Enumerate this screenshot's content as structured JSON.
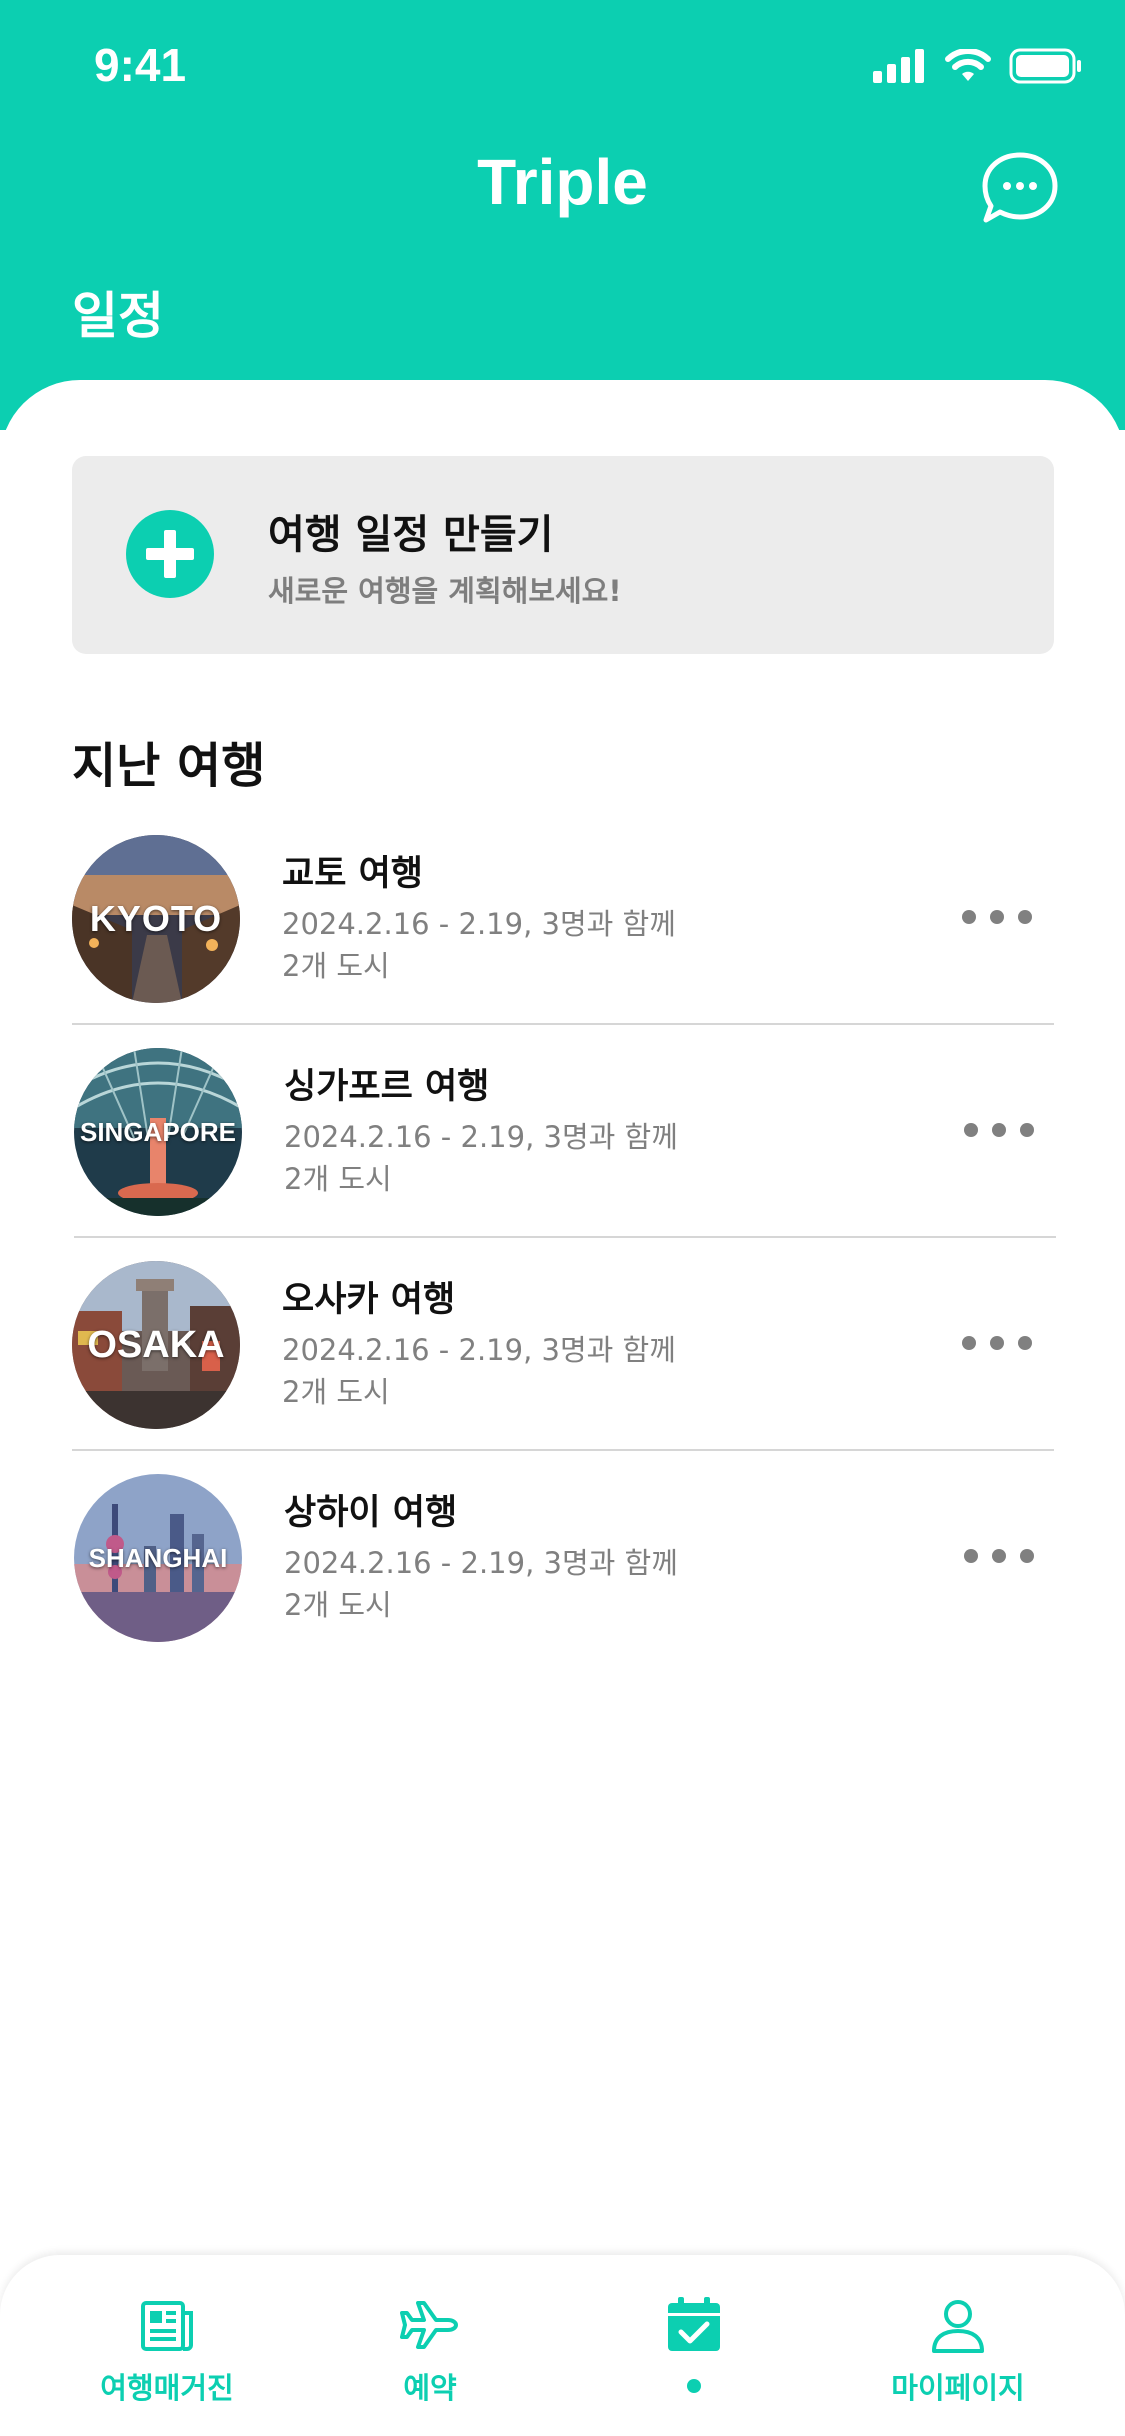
{
  "colors": {
    "accent": "#0ccfb1",
    "card_bg": "#ececec",
    "secondary_text": "#808080"
  },
  "status_bar": {
    "time": "9:41",
    "icons": [
      "signal-icon",
      "wifi-icon",
      "battery-icon"
    ]
  },
  "header": {
    "app_title": "Triple",
    "page_heading": "일정",
    "chat_icon": "chat-bubble-icon"
  },
  "create_card": {
    "title": "여행 일정 만들기",
    "subtitle": "새로운 여행을 계획해보세요!",
    "icon": "plus-circle-icon"
  },
  "past_trips": {
    "section_title": "지난 여행",
    "items": [
      {
        "thumb_label": "KYOTO",
        "name": "교토 여행",
        "dates": "2024.2.16 - 2.19, 3명과 함께",
        "cities": "2개 도시"
      },
      {
        "thumb_label": "SINGAPORE",
        "name": "싱가포르 여행",
        "dates": "2024.2.16 - 2.19, 3명과 함께",
        "cities": "2개 도시"
      },
      {
        "thumb_label": "OSAKA",
        "name": "오사카 여행",
        "dates": "2024.2.16 - 2.19, 3명과 함께",
        "cities": "2개 도시"
      },
      {
        "thumb_label": "SHANGHAI",
        "name": "상하이 여행",
        "dates": "2024.2.16 - 2.19, 3명과 함께",
        "cities": "2개 도시"
      }
    ]
  },
  "tab_bar": {
    "items": [
      {
        "label": "여행매거진",
        "icon": "magazine-icon"
      },
      {
        "label": "예약",
        "icon": "airplane-icon"
      },
      {
        "label": "",
        "icon": "calendar-check-icon",
        "active": true
      },
      {
        "label": "마이페이지",
        "icon": "person-icon"
      }
    ]
  }
}
